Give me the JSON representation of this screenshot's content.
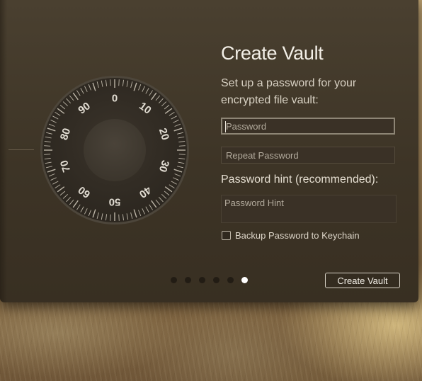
{
  "dialog": {
    "title": "Create Vault",
    "subtitle": "Set up a password for your encrypted file vault:",
    "password_field": {
      "placeholder": "Password",
      "value": ""
    },
    "repeat_password_field": {
      "placeholder": "Repeat Password",
      "value": ""
    },
    "hint_label": "Password hint (recommended):",
    "hint_field": {
      "placeholder": "Password Hint",
      "value": ""
    },
    "keychain_checkbox": {
      "label": "Backup Password to Keychain",
      "checked": false
    },
    "create_button_label": "Create Vault",
    "pagination": {
      "total": 6,
      "current": 6
    }
  },
  "dial": {
    "icon": "combination-lock-dial-icon",
    "numbers": [
      "0",
      "10",
      "20",
      "30",
      "40",
      "50",
      "60",
      "70",
      "80",
      "90"
    ]
  },
  "colors": {
    "panel": "#3f3628",
    "accent_text": "#f3efe7",
    "active_dot": "#ffffff",
    "inactive_dot": "#221c14"
  }
}
